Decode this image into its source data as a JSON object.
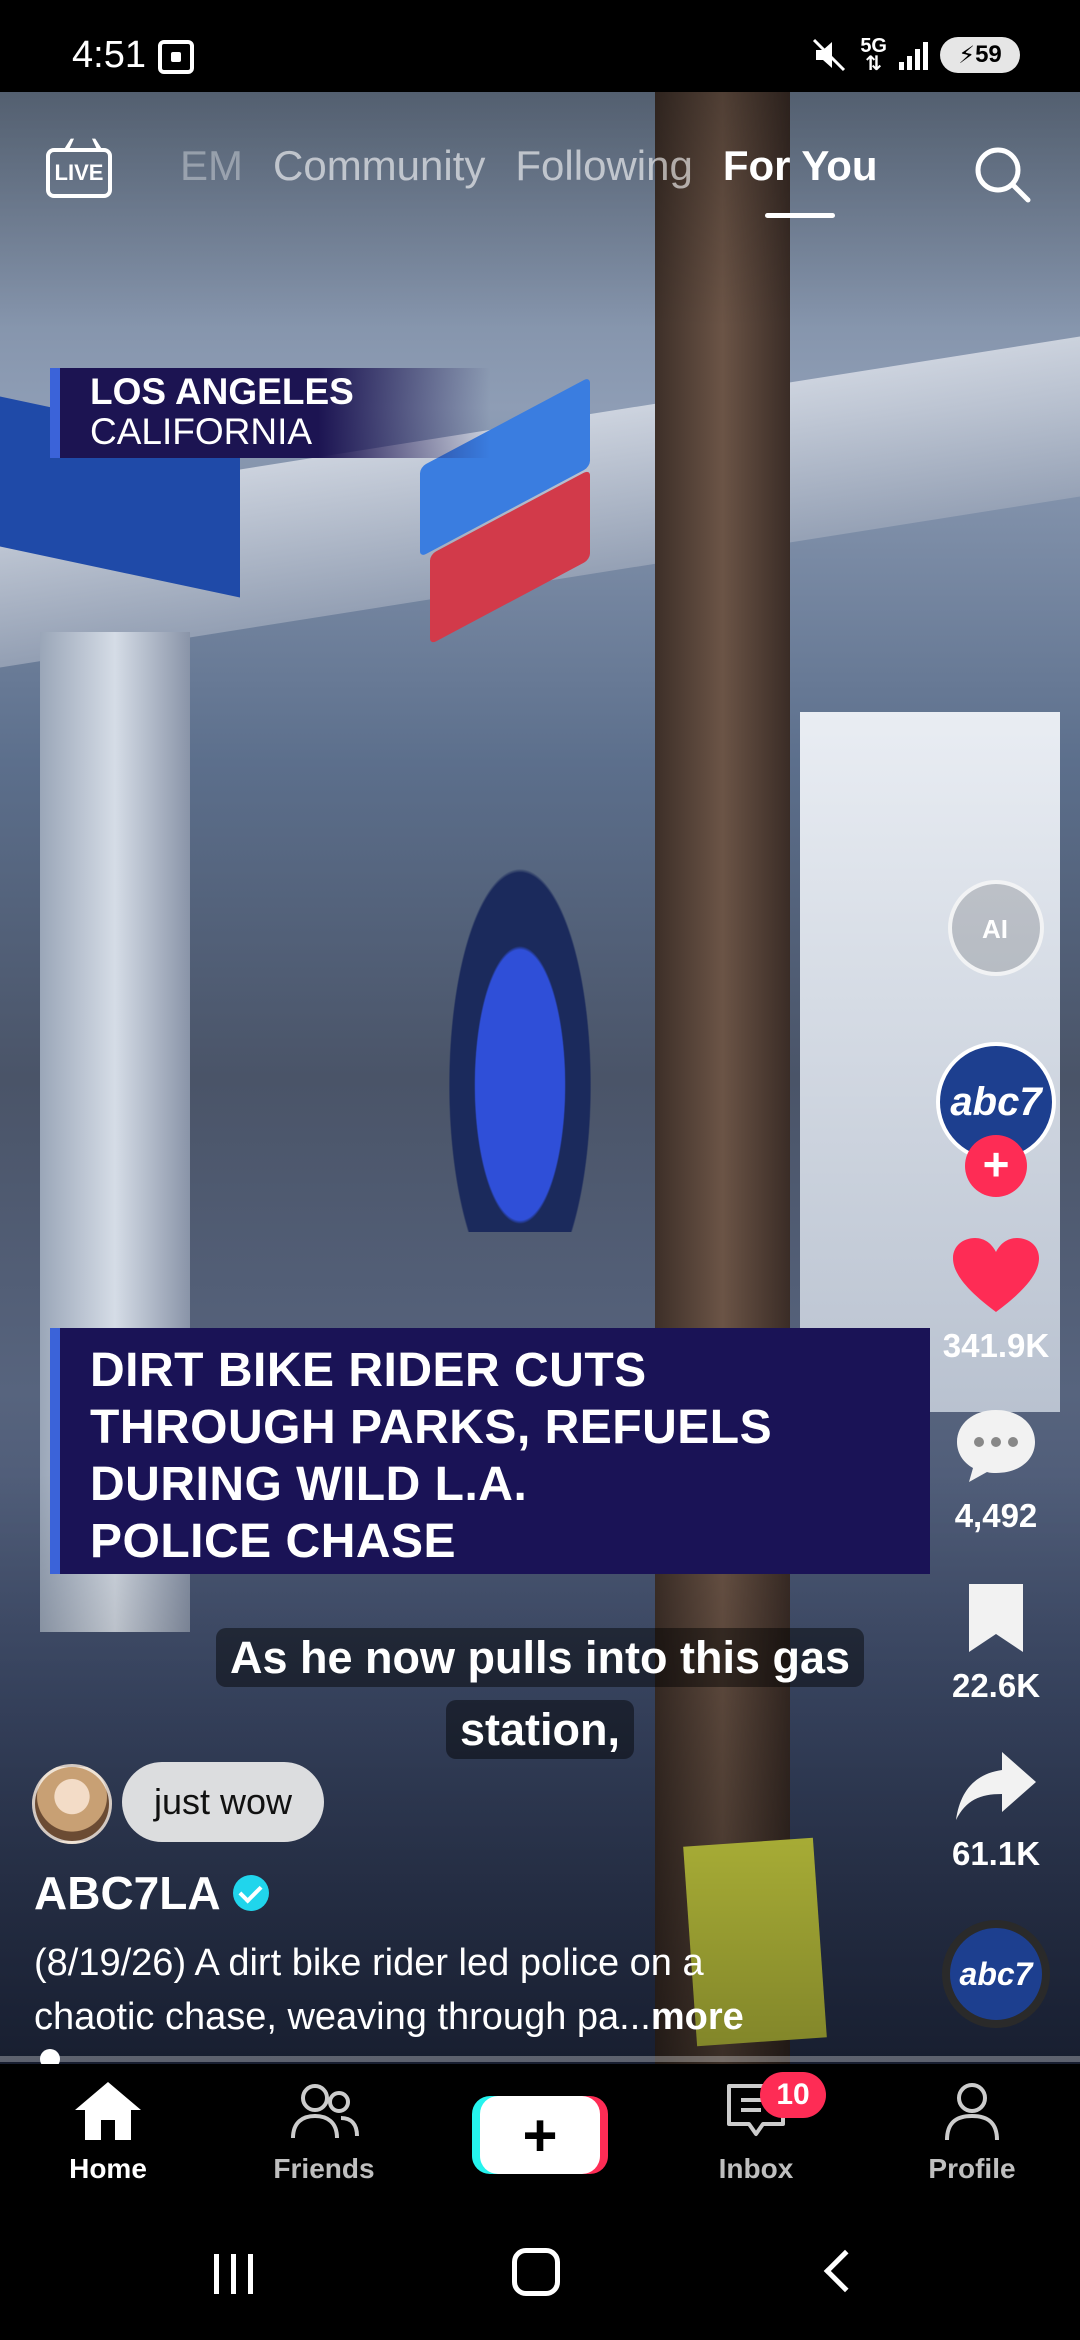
{
  "status_bar": {
    "time": "4:51",
    "network": "5G",
    "battery": "59"
  },
  "top_nav": {
    "live_label": "LIVE",
    "tabs": [
      "EM",
      "Community",
      "Following",
      "For You"
    ],
    "active_tab": "For You"
  },
  "video": {
    "location_line1": "LOS ANGELES",
    "location_line2": "CALIFORNIA",
    "headline": [
      "DIRT BIKE RIDER CUTS",
      "THROUGH PARKS, REFUELS",
      "DURING WILD L.A.",
      "POLICE CHASE"
    ],
    "caption_line1": "As he now pulls into this gas",
    "caption_line2": "station,"
  },
  "comment": {
    "text": "just wow"
  },
  "author": {
    "name": "ABC7LA",
    "verified": true
  },
  "description": {
    "line1": "(8/19/26) A dirt bike rider led police on a",
    "line2": "chaotic chase, weaving through pa...",
    "more": "more"
  },
  "rail": {
    "creator_logo": "abc7",
    "likes": "341.9K",
    "comments": "4,492",
    "saves": "22.6K",
    "shares": "61.1K",
    "like_color": "#fe2c55"
  },
  "progress": {
    "fraction": 0.02
  },
  "bottom_nav": {
    "home": "Home",
    "friends": "Friends",
    "inbox": "Inbox",
    "profile": "Profile",
    "inbox_badge": "10"
  },
  "colors": {
    "accent_red": "#fe2c55",
    "accent_cyan": "#25f4ee",
    "headline_bg": "#1a1356",
    "verified": "#20d5ec"
  }
}
